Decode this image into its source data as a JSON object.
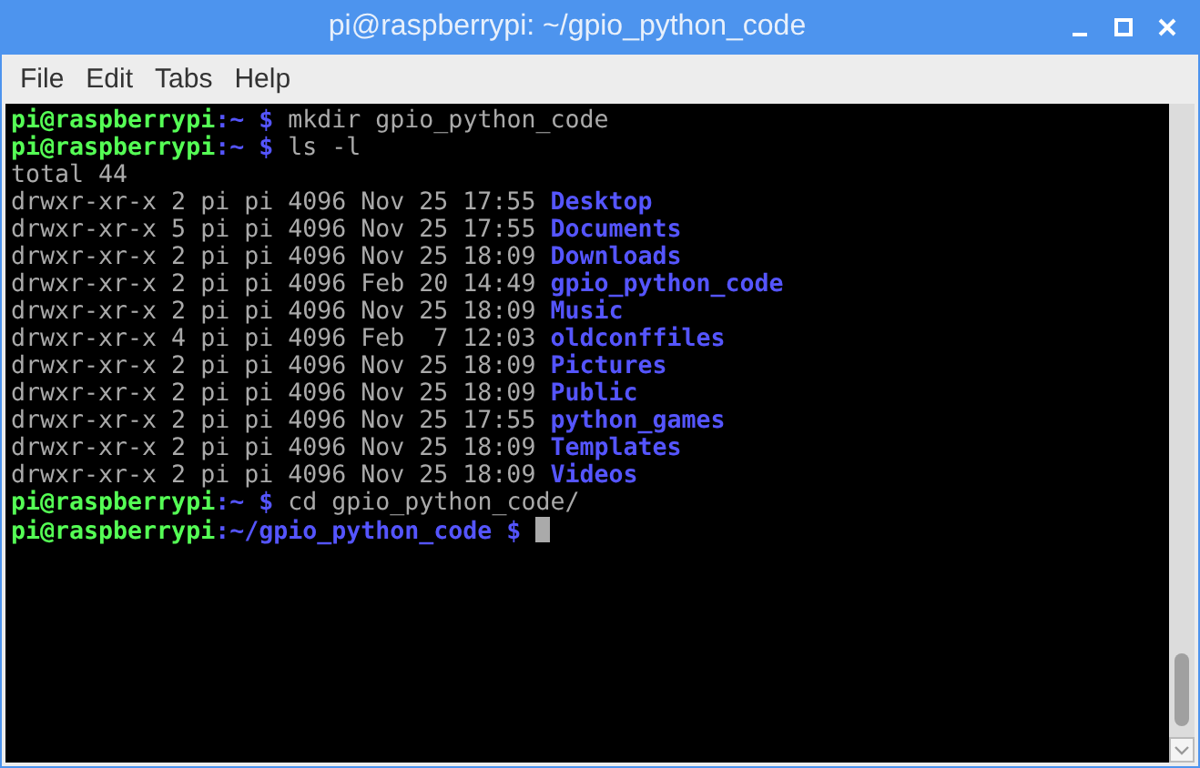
{
  "window": {
    "title": "pi@raspberrypi: ~/gpio_python_code"
  },
  "menu": [
    "File",
    "Edit",
    "Tabs",
    "Help"
  ],
  "terminal": {
    "lines": [
      [
        {
          "kind": "user",
          "text": "pi@raspberrypi"
        },
        {
          "kind": "path",
          "text": ":~ $"
        },
        {
          "kind": "text",
          "text": "mkdir gpio_python_code"
        }
      ],
      [
        {
          "kind": "user",
          "text": "pi@raspberrypi"
        },
        {
          "kind": "path",
          "text": ":~ $"
        },
        {
          "kind": "text",
          "text": "ls -l"
        }
      ],
      [
        {
          "kind": "text",
          "text": "total 44"
        }
      ],
      [
        {
          "kind": "text",
          "text": "drwxr-xr-x 2 pi pi 4096 Nov 25 17:55"
        },
        {
          "kind": "dir",
          "text": "Desktop"
        }
      ],
      [
        {
          "kind": "text",
          "text": "drwxr-xr-x 5 pi pi 4096 Nov 25 17:55"
        },
        {
          "kind": "dir",
          "text": "Documents"
        }
      ],
      [
        {
          "kind": "text",
          "text": "drwxr-xr-x 2 pi pi 4096 Nov 25 18:09"
        },
        {
          "kind": "dir",
          "text": "Downloads"
        }
      ],
      [
        {
          "kind": "text",
          "text": "drwxr-xr-x 2 pi pi 4096 Feb 20 14:49"
        },
        {
          "kind": "dir",
          "text": "gpio_python_code"
        }
      ],
      [
        {
          "kind": "text",
          "text": "drwxr-xr-x 2 pi pi 4096 Nov 25 18:09"
        },
        {
          "kind": "dir",
          "text": "Music"
        }
      ],
      [
        {
          "kind": "text",
          "text": "drwxr-xr-x 4 pi pi 4096 Feb  7 12:03"
        },
        {
          "kind": "dir",
          "text": "oldconffiles"
        }
      ],
      [
        {
          "kind": "text",
          "text": "drwxr-xr-x 2 pi pi 4096 Nov 25 18:09"
        },
        {
          "kind": "dir",
          "text": "Pictures"
        }
      ],
      [
        {
          "kind": "text",
          "text": "drwxr-xr-x 2 pi pi 4096 Nov 25 18:09"
        },
        {
          "kind": "dir",
          "text": "Public"
        }
      ],
      [
        {
          "kind": "text",
          "text": "drwxr-xr-x 2 pi pi 4096 Nov 25 17:55"
        },
        {
          "kind": "dir",
          "text": "python_games"
        }
      ],
      [
        {
          "kind": "text",
          "text": "drwxr-xr-x 2 pi pi 4096 Nov 25 18:09"
        },
        {
          "kind": "dir",
          "text": "Templates"
        }
      ],
      [
        {
          "kind": "text",
          "text": "drwxr-xr-x 2 pi pi 4096 Nov 25 18:09"
        },
        {
          "kind": "dir",
          "text": "Videos"
        }
      ],
      [
        {
          "kind": "user",
          "text": "pi@raspberrypi"
        },
        {
          "kind": "path",
          "text": ":~ $"
        },
        {
          "kind": "text",
          "text": "cd gpio_python_code/"
        }
      ],
      [
        {
          "kind": "user",
          "text": "pi@raspberrypi"
        },
        {
          "kind": "path",
          "text": ":~/gpio_python_code $"
        },
        {
          "kind": "cursor"
        }
      ]
    ]
  }
}
